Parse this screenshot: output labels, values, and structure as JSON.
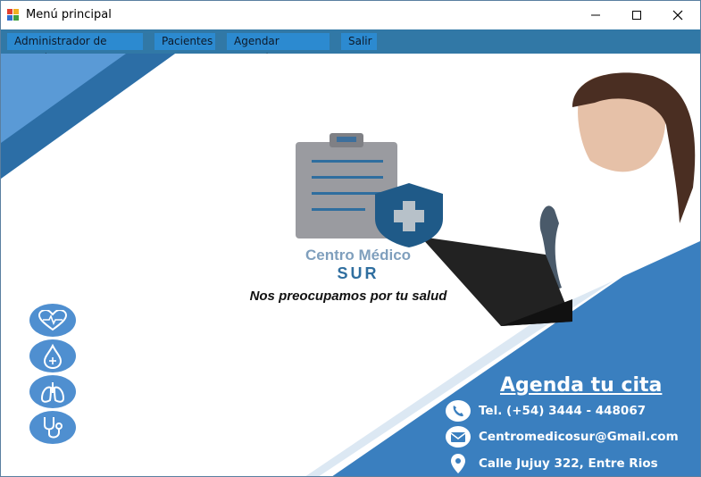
{
  "window": {
    "title": "Menú principal",
    "controls": {
      "minimize_icon": "minimize-icon",
      "maximize_icon": "maximize-icon",
      "close_icon": "close-icon"
    }
  },
  "menu": {
    "items": [
      {
        "label": "Administrador de usuario"
      },
      {
        "label": "Pacientes"
      },
      {
        "label": "Agendar consultas"
      },
      {
        "label": "Salir"
      }
    ]
  },
  "banner": {
    "brand_name": "Centro Médico",
    "brand_sub": "SUR",
    "tagline": "Nos preocupamos por tu salud",
    "cta": "Agenda tu cita",
    "phone": "Tel. (+54) 3444 - 448067",
    "email": "Centromedicosur@Gmail.com",
    "address": "Calle Jujuy 322, Entre Rios",
    "side_icons": [
      "heart-pulse-icon",
      "drop-icon",
      "lungs-icon",
      "stethoscope-icon"
    ]
  },
  "colors": {
    "menubar": "#3178a6",
    "menu_item": "#2c8ad0",
    "accent": "#3a7fbf",
    "brand_dark": "#2f6e9f"
  }
}
